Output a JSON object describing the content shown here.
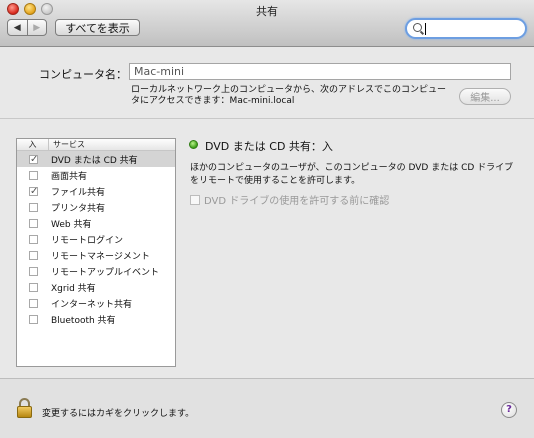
{
  "window": {
    "title": "共有"
  },
  "toolbar": {
    "back_glyph": "◀",
    "forward_glyph": "▶",
    "show_all_label": "すべてを表示",
    "search": {
      "value": "",
      "placeholder": ""
    }
  },
  "computer_name": {
    "label": "コンピュータ名：",
    "value": "Mac-mini",
    "description": "ローカルネットワーク上のコンピュータから、次のアドレスでこのコンピュータにアクセスできます：Mac-mini.local",
    "edit_label": "編集..."
  },
  "services": {
    "header_on": "入",
    "header_service": "サービス",
    "items": [
      {
        "label": "DVD または CD 共有",
        "checked": true,
        "selected": true
      },
      {
        "label": "画面共有",
        "checked": false,
        "selected": false
      },
      {
        "label": "ファイル共有",
        "checked": true,
        "selected": false
      },
      {
        "label": "プリンタ共有",
        "checked": false,
        "selected": false
      },
      {
        "label": "Web 共有",
        "checked": false,
        "selected": false
      },
      {
        "label": "リモートログイン",
        "checked": false,
        "selected": false
      },
      {
        "label": "リモートマネージメント",
        "checked": false,
        "selected": false
      },
      {
        "label": "リモートアップルイベント",
        "checked": false,
        "selected": false
      },
      {
        "label": "Xgrid 共有",
        "checked": false,
        "selected": false
      },
      {
        "label": "インターネット共有",
        "checked": false,
        "selected": false
      },
      {
        "label": "Bluetooth 共有",
        "checked": false,
        "selected": false
      }
    ]
  },
  "detail": {
    "status": "DVD または CD 共有：入",
    "status_color": "#3c9d18",
    "description": "ほかのコンピュータのユーザが、このコンピュータの DVD または CD ドライブをリモートで使用することを許可します。",
    "confirm_label": "DVD ドライブの使用を許可する前に確認"
  },
  "footer": {
    "lock_text": "変更するにはカギをクリックします。",
    "help_glyph": "?"
  }
}
